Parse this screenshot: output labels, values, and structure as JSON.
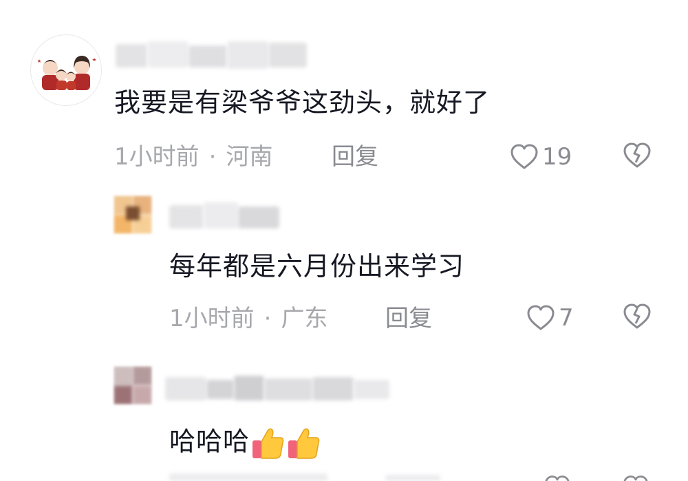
{
  "comments": [
    {
      "text": "我要是有梁爷爷这劲头，就好了",
      "time": "1小时前",
      "location": "河南",
      "reply_label": "回复",
      "likes": "19"
    },
    {
      "text": "每年都是六月份出来学习",
      "time": "1小时前",
      "location": "广东",
      "reply_label": "回复",
      "likes": "7"
    },
    {
      "text": "哈哈哈",
      "emojis": [
        "thumbs-up-icon",
        "thumbs-up-icon"
      ]
    }
  ],
  "meta_separator": "·",
  "colors": {
    "text": "#161823",
    "meta": "#a7a8ad",
    "action": "#8a8b91"
  }
}
